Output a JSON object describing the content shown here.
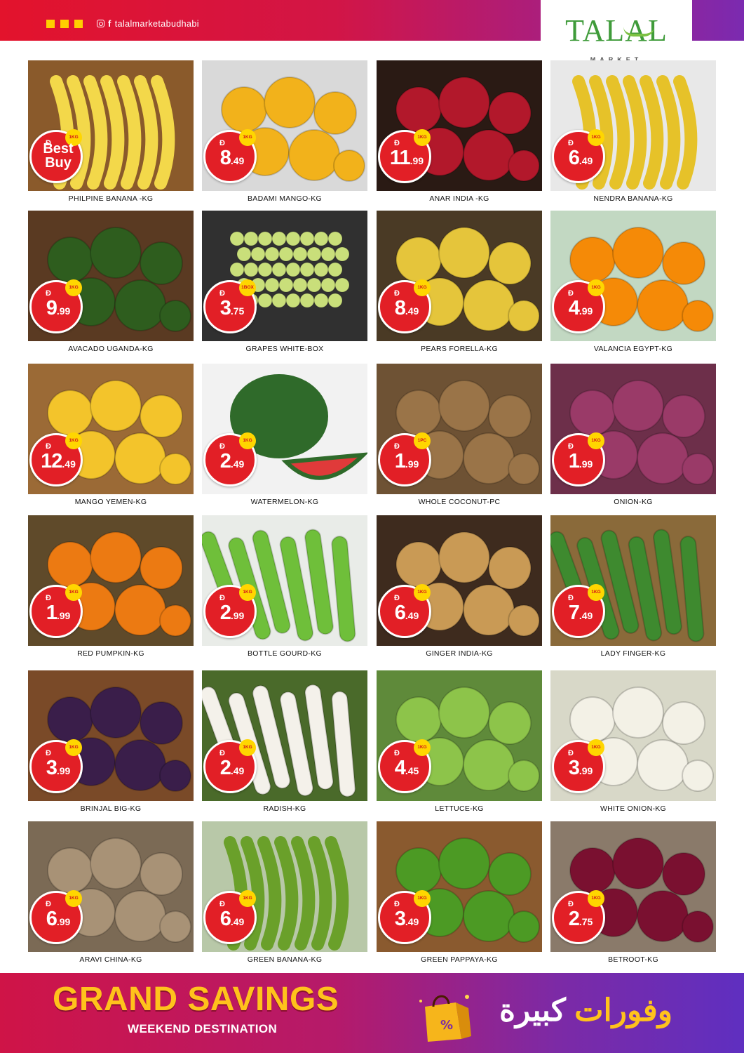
{
  "header": {
    "social_handle": "talalmarketabudhabi",
    "instagram_icon": "instagram-icon",
    "facebook_icon": "facebook-icon",
    "logo_text": "TALAL",
    "logo_subtext": "MARKET"
  },
  "colors": {
    "badge_red": "#e21f26",
    "unit_yellow": "#ffd600",
    "header_start": "#e3132c",
    "header_end": "#7b2ab0",
    "brand_green": "#3f9b3a"
  },
  "products": [
    {
      "name": "PHILPINE BANANA -KG",
      "unit": "1KG",
      "badge": "Best Buy",
      "price_int": "",
      "price_dec": "",
      "image": "bananas-basket"
    },
    {
      "name": "BADAMI MANGO-KG",
      "unit": "1KG",
      "badge": "",
      "price_int": "8",
      "price_dec": ".49",
      "image": "mangoes-bowl"
    },
    {
      "name": "ANAR INDIA -KG",
      "unit": "1KG",
      "badge": "",
      "price_int": "11",
      "price_dec": ".99",
      "image": "pomegranate"
    },
    {
      "name": "NENDRA BANANA-KG",
      "unit": "1KG",
      "badge": "",
      "price_int": "6",
      "price_dec": ".49",
      "image": "nendra-banana"
    },
    {
      "name": "AVACADO UGANDA-KG",
      "unit": "1KG",
      "badge": "",
      "price_int": "9",
      "price_dec": ".99",
      "image": "avocado"
    },
    {
      "name": "GRAPES WHITE-BOX",
      "unit": "1BOX",
      "badge": "",
      "price_int": "3",
      "price_dec": ".75",
      "image": "grapes"
    },
    {
      "name": "PEARS FORELLA-KG",
      "unit": "1KG",
      "badge": "",
      "price_int": "8",
      "price_dec": ".49",
      "image": "pears-basket"
    },
    {
      "name": "VALANCIA EGYPT-KG",
      "unit": "1KG",
      "badge": "",
      "price_int": "4",
      "price_dec": ".99",
      "image": "oranges"
    },
    {
      "name": "MANGO YEMEN-KG",
      "unit": "1KG",
      "badge": "",
      "price_int": "12",
      "price_dec": ".49",
      "image": "mango-yemen"
    },
    {
      "name": "WATERMELON-KG",
      "unit": "1KG",
      "badge": "",
      "price_int": "2",
      "price_dec": ".49",
      "image": "watermelon"
    },
    {
      "name": "WHOLE COCONUT-PC",
      "unit": "1PC",
      "badge": "",
      "price_int": "1",
      "price_dec": ".99",
      "image": "coconut"
    },
    {
      "name": "ONION-KG",
      "unit": "1KG",
      "badge": "",
      "price_int": "1",
      "price_dec": ".99",
      "image": "red-onion"
    },
    {
      "name": "RED PUMPKIN-KG",
      "unit": "1KG",
      "badge": "",
      "price_int": "1",
      "price_dec": ".99",
      "image": "pumpkin"
    },
    {
      "name": "BOTTLE GOURD-KG",
      "unit": "1KG",
      "badge": "",
      "price_int": "2",
      "price_dec": ".99",
      "image": "bottle-gourd"
    },
    {
      "name": "GINGER INDIA-KG",
      "unit": "1KG",
      "badge": "",
      "price_int": "6",
      "price_dec": ".49",
      "image": "ginger"
    },
    {
      "name": "LADY FINGER-KG",
      "unit": "1KG",
      "badge": "",
      "price_int": "7",
      "price_dec": ".49",
      "image": "okra"
    },
    {
      "name": "BRINJAL BIG-KG",
      "unit": "1KG",
      "badge": "",
      "price_int": "3",
      "price_dec": ".99",
      "image": "brinjal"
    },
    {
      "name": "RADISH-KG",
      "unit": "1KG",
      "badge": "",
      "price_int": "2",
      "price_dec": ".49",
      "image": "radish"
    },
    {
      "name": "LETTUCE-KG",
      "unit": "1KG",
      "badge": "",
      "price_int": "4",
      "price_dec": ".45",
      "image": "lettuce"
    },
    {
      "name": "WHITE ONION-KG",
      "unit": "1KG",
      "badge": "",
      "price_int": "3",
      "price_dec": ".99",
      "image": "white-onion"
    },
    {
      "name": "ARAVI CHINA-KG",
      "unit": "1KG",
      "badge": "",
      "price_int": "6",
      "price_dec": ".99",
      "image": "aravi"
    },
    {
      "name": "GREEN BANANA-KG",
      "unit": "1KG",
      "badge": "",
      "price_int": "6",
      "price_dec": ".49",
      "image": "green-banana"
    },
    {
      "name": "GREEN PAPPAYA-KG",
      "unit": "1KG",
      "badge": "",
      "price_int": "3",
      "price_dec": ".49",
      "image": "papaya"
    },
    {
      "name": "BETROOT-KG",
      "unit": "1KG",
      "badge": "",
      "price_int": "2",
      "price_dec": ".75",
      "image": "beetroot"
    }
  ],
  "footer": {
    "headline": "GRAND SAVINGS",
    "subline": "WEEKEND DESTINATION",
    "arabic_part1": "وفورات",
    "arabic_part2": "كبيرة",
    "bag_icon": "shopping-bag-icon"
  }
}
